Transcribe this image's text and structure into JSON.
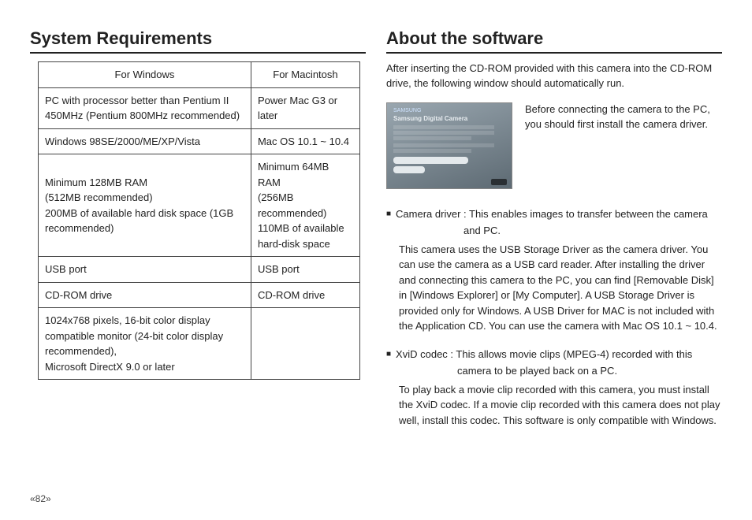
{
  "pageNumber": "«82»",
  "left": {
    "heading": "System Requirements",
    "headers": {
      "win": "For Windows",
      "mac": "For Macintosh"
    },
    "rows": [
      {
        "win": "PC with processor better than Pentium II 450MHz (Pentium 800MHz recommended)",
        "mac": "Power Mac G3 or later"
      },
      {
        "win": "Windows 98SE/2000/ME/XP/Vista",
        "mac": "Mac OS 10.1 ~ 10.4"
      },
      {
        "win": "Minimum 128MB RAM\n(512MB recommended)\n200MB of available hard disk space (1GB recommended)",
        "mac": "Minimum 64MB RAM\n(256MB recommended)\n110MB of available hard-disk space"
      },
      {
        "win": "USB port",
        "mac": "USB port"
      },
      {
        "win": "CD-ROM drive",
        "mac": "CD-ROM drive"
      },
      {
        "win": "1024x768 pixels, 16-bit color display compatible monitor (24-bit color display recommended),\nMicrosoft DirectX 9.0 or later",
        "mac": ""
      }
    ]
  },
  "right": {
    "heading": "About the software",
    "intro": "After inserting the CD-ROM provided with this camera into the CD-ROM drive, the following window should automatically run.",
    "panel": {
      "brand": "SAMSUNG",
      "title": "Samsung Digital Camera"
    },
    "note": "Before connecting the camera to the PC, you should first install the camera driver.",
    "items": [
      {
        "label": "Camera driver :",
        "head": "This enables images to transfer between the camera",
        "hang": "and PC.",
        "desc": "This camera uses the USB Storage Driver as the camera driver. You can use the camera as a USB card reader. After installing the driver and connecting this camera to the PC, you can find [Removable Disk] in [Windows Explorer] or [My Computer]. A USB Storage Driver is provided only for Windows. A USB Driver for MAC is not included with the Application CD. You can use the camera with Mac OS 10.1 ~ 10.4."
      },
      {
        "label": "XviD codec :",
        "head": "This allows movie clips (MPEG-4) recorded with this",
        "hang": "camera to be played back on a PC.",
        "desc": "To play back a movie clip recorded with this camera, you must install the XviD codec. If a movie clip recorded with this camera does not play well, install this codec. This software is only compatible with Windows."
      }
    ]
  }
}
